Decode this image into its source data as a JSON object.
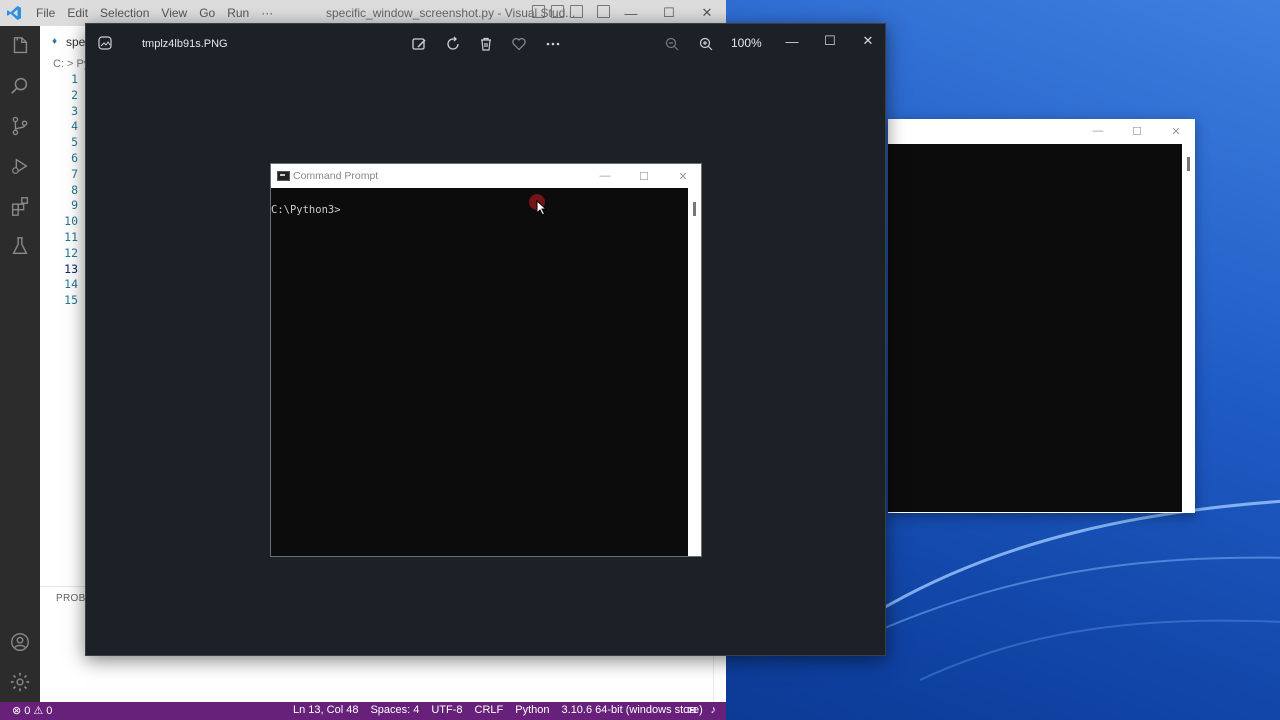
{
  "vscode": {
    "menu": [
      "File",
      "Edit",
      "Selection",
      "View",
      "Go",
      "Run",
      "···"
    ],
    "window_title": "specific_window_screenshot.py - Visual Stud...",
    "tab_label": "spe",
    "breadcrumb": "C: > Py",
    "line_numbers": [
      "1",
      "2",
      "3",
      "4",
      "5",
      "6",
      "7",
      "8",
      "9",
      "10",
      "11",
      "12",
      "13",
      "14",
      "15"
    ],
    "active_line": "13",
    "panel_label": "PROBL",
    "status": {
      "errors": "0",
      "warnings": "0",
      "position": "Ln 13, Col 48",
      "spaces": "Spaces: 4",
      "encoding": "UTF-8",
      "eol": "CRLF",
      "language": "Python",
      "interpreter": "3.10.6 64-bit (windows store)"
    },
    "accent_color": "#68217a"
  },
  "photos": {
    "filename": "tmplz4lb91s.PNG",
    "zoom": "100%",
    "tools": [
      "edit-image-icon",
      "rotate-icon",
      "delete-icon",
      "favorite-icon",
      "more-icon"
    ]
  },
  "cmd": {
    "title": "Command Prompt",
    "prompt": "C:\\Python3>"
  }
}
